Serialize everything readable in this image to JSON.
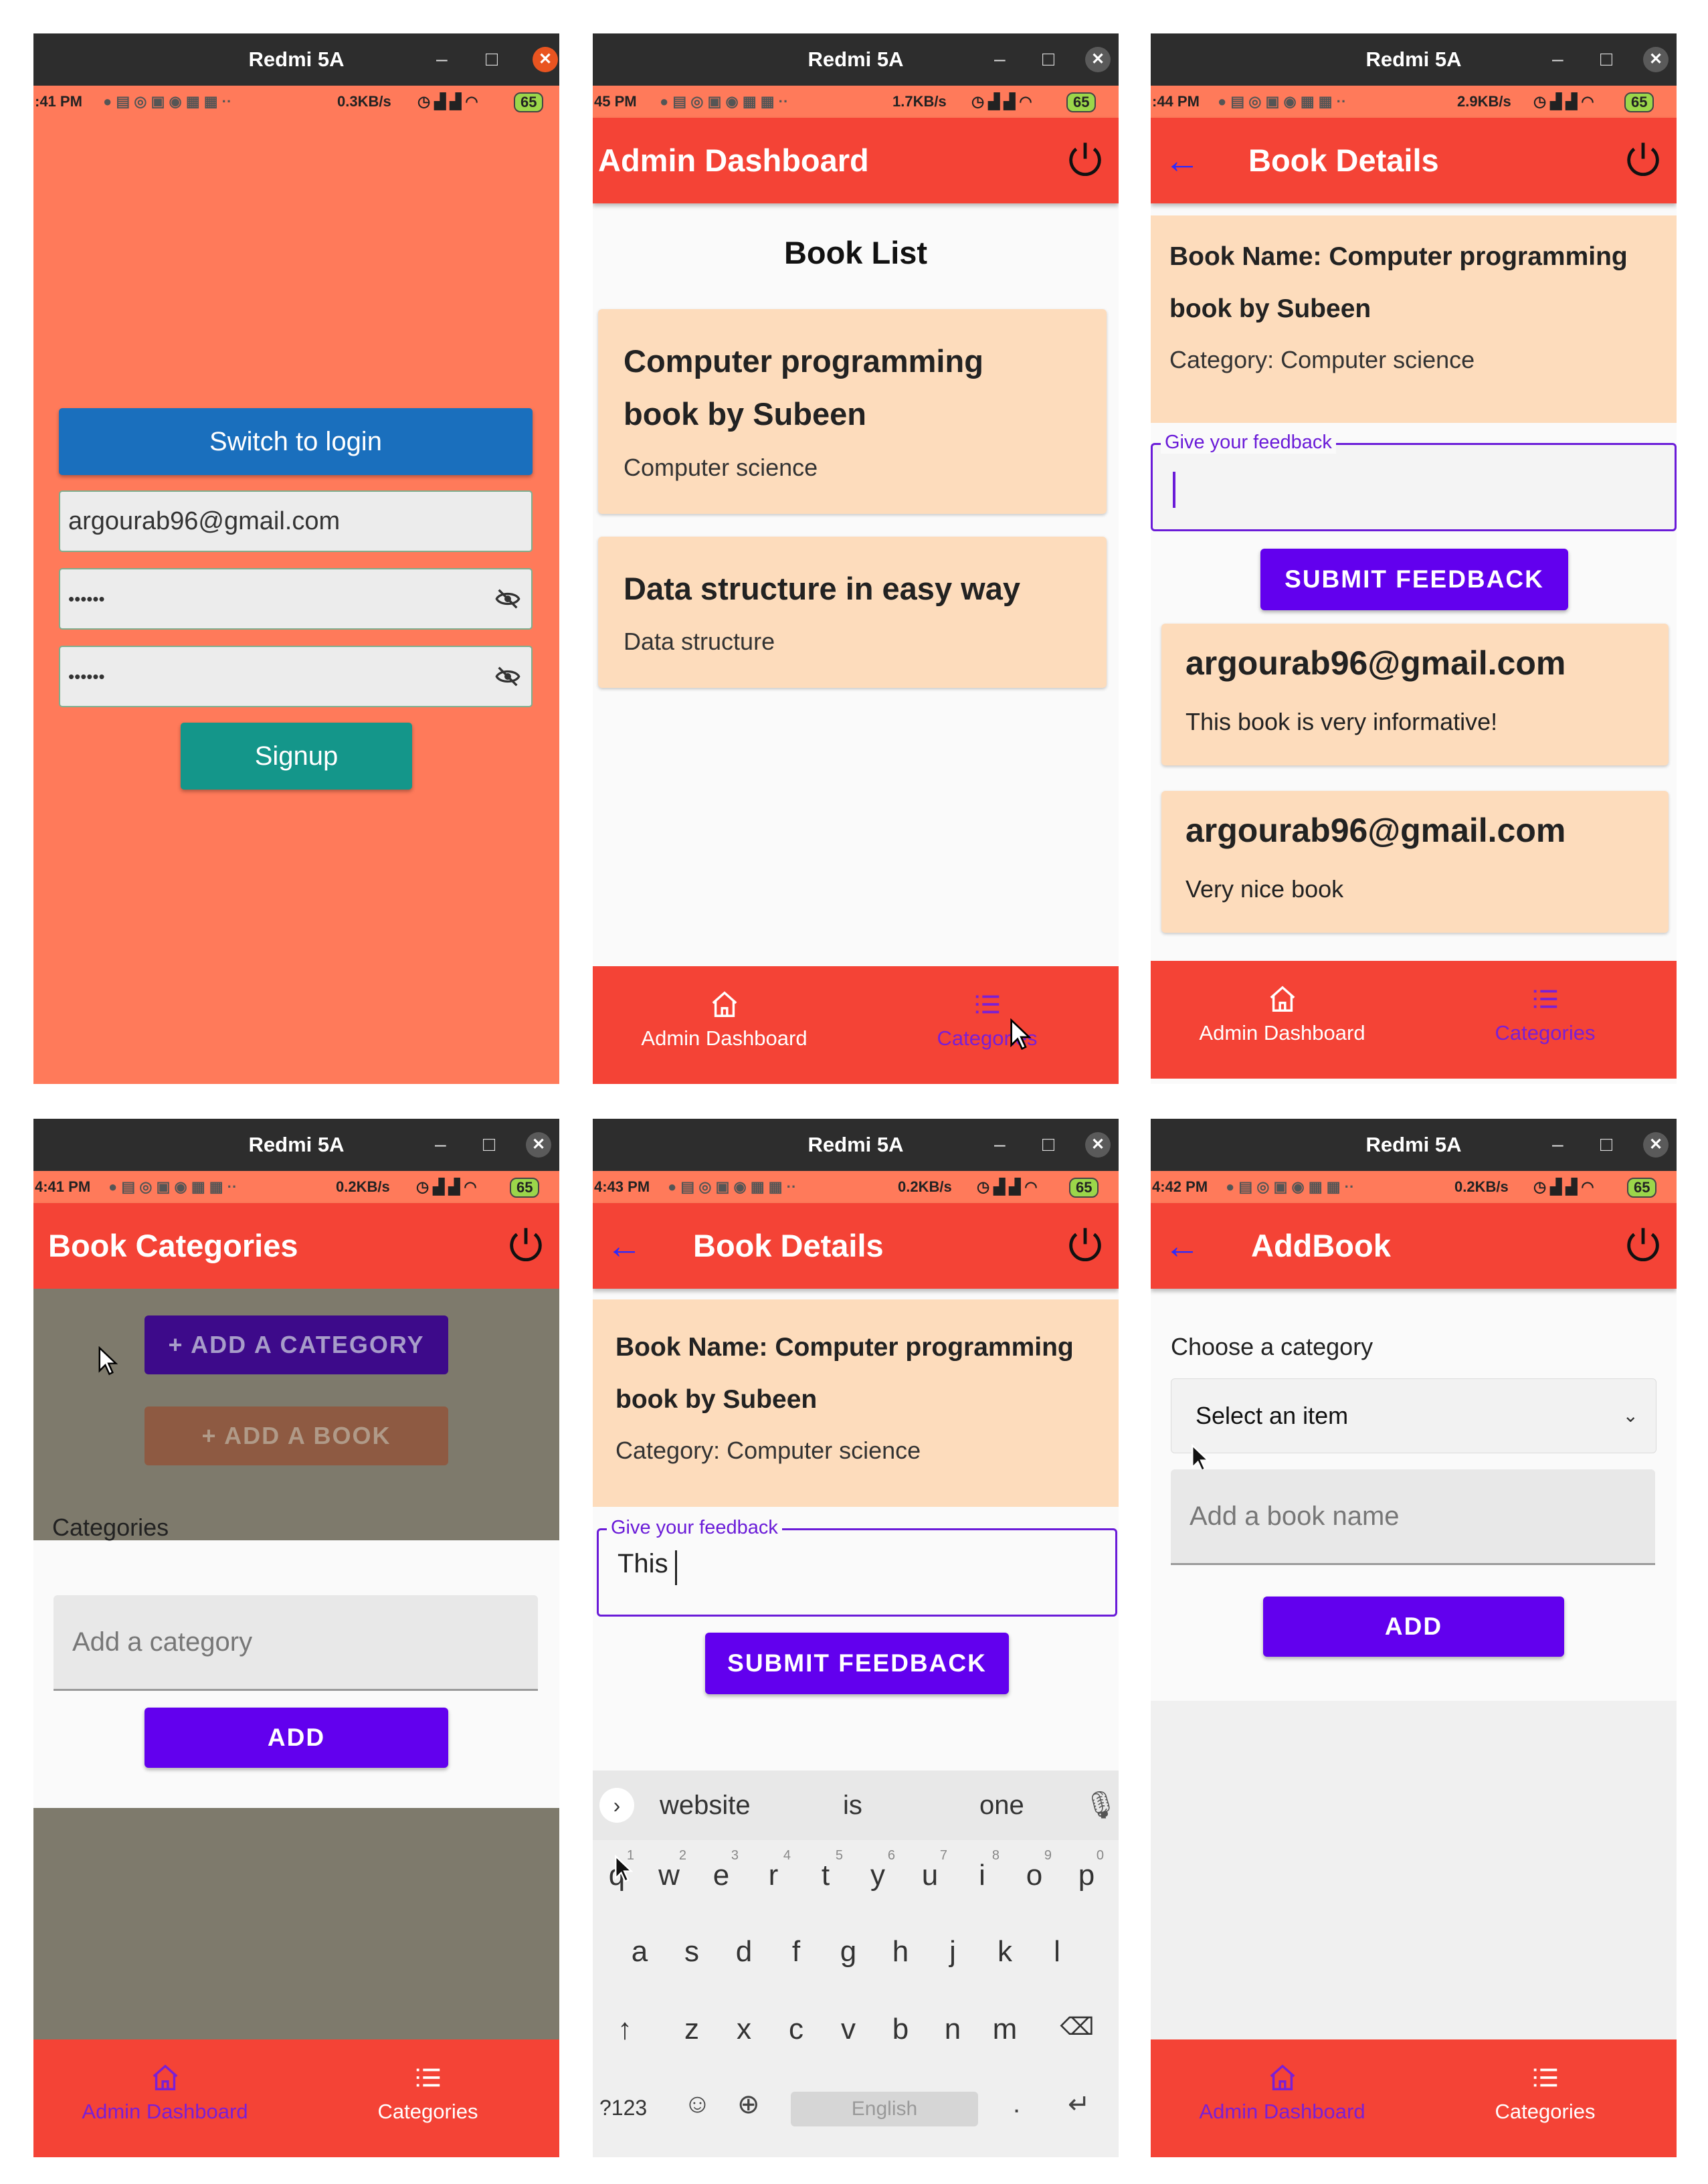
{
  "screens": {
    "signup": {
      "window_title": "Redmi 5A",
      "status": {
        "time": ":41 PM",
        "speed": "0.3KB/s",
        "battery": "65"
      },
      "switch_label": "Switch to login",
      "email_value": "argourab96@gmail.com",
      "password_mask": "••••••",
      "confirm_mask": "••••••",
      "signup_label": "Signup"
    },
    "admin_dashboard": {
      "window_title": "Redmi 5A",
      "status": {
        "time": "45 PM",
        "speed": "1.7KB/s",
        "battery": "65"
      },
      "app_title": "Admin Dashboard",
      "list_title": "Book List",
      "books": [
        {
          "name_line1": "Computer programming",
          "name_line2": "book by Subeen",
          "category": "Computer science"
        },
        {
          "name_line1": "Data structure in easy way",
          "category": "Data structure"
        }
      ],
      "nav": {
        "dashboard": "Admin Dashboard",
        "categories": "Categories"
      }
    },
    "book_details_feedback": {
      "window_title": "Redmi 5A",
      "status": {
        "time": ":44 PM",
        "speed": "2.9KB/s",
        "battery": "65"
      },
      "app_title": "Book Details",
      "book_name_line1": "Book Name: Computer programming",
      "book_name_line2": "book by Subeen",
      "category": "Category: Computer science",
      "feedback_label": "Give your feedback",
      "submit_label": "SUBMIT FEEDBACK",
      "feedbacks": [
        {
          "user": "argourab96@gmail.com",
          "text": "This book is very informative!"
        },
        {
          "user": "argourab96@gmail.com",
          "text": "Very nice book"
        }
      ],
      "nav": {
        "dashboard": "Admin Dashboard",
        "categories": "Categories"
      }
    },
    "book_categories": {
      "window_title": "Redmi 5A",
      "status": {
        "time": "4:41 PM",
        "speed": "0.2KB/s",
        "battery": "65"
      },
      "app_title": "Book Categories",
      "add_category_btn": "+ ADD A CATEGORY",
      "add_book_btn": "+ ADD A BOOK",
      "categories_heading": "Categories",
      "input_placeholder": "Add a category",
      "add_label": "ADD",
      "nav": {
        "dashboard": "Admin Dashboard",
        "categories": "Categories"
      }
    },
    "book_details_typing": {
      "window_title": "Redmi 5A",
      "status": {
        "time": "4:43 PM",
        "speed": "0.2KB/s",
        "battery": "65"
      },
      "app_title": "Book Details",
      "book_name_line1": "Book Name: Computer programming",
      "book_name_line2": "book by Subeen",
      "category": "Category: Computer science",
      "feedback_label": "Give your feedback",
      "feedback_value": "This",
      "submit_label": "SUBMIT FEEDBACK",
      "keyboard": {
        "suggestions": [
          "website",
          "is",
          "one"
        ],
        "row1": [
          "q",
          "w",
          "e",
          "r",
          "t",
          "y",
          "u",
          "i",
          "o",
          "p"
        ],
        "row1_hints": [
          "1",
          "2",
          "3",
          "4",
          "5",
          "6",
          "7",
          "8",
          "9",
          "0"
        ],
        "row2": [
          "a",
          "s",
          "d",
          "f",
          "g",
          "h",
          "j",
          "k",
          "l"
        ],
        "row3": [
          "z",
          "x",
          "c",
          "v",
          "b",
          "n",
          "m"
        ],
        "symbols": "?123",
        "space": "English",
        "period": "."
      }
    },
    "add_book": {
      "window_title": "Redmi 5A",
      "status": {
        "time": "4:42 PM",
        "speed": "0.2KB/s",
        "battery": "65"
      },
      "app_title": "AddBook",
      "choose_label": "Choose a category",
      "select_value": "Select an item",
      "book_name_placeholder": "Add a book name",
      "add_label": "ADD",
      "nav": {
        "dashboard": "Admin Dashboard",
        "categories": "Categories"
      }
    }
  },
  "colors": {
    "app_red": "#f44336",
    "salmon_bg": "#ff7a5a",
    "login_blue": "#1a6fbd",
    "signup_teal": "#14968a",
    "card_peach": "#fddcbc",
    "button_purple": "#6200ee",
    "nav_purple_label": "#7a1fd6"
  }
}
